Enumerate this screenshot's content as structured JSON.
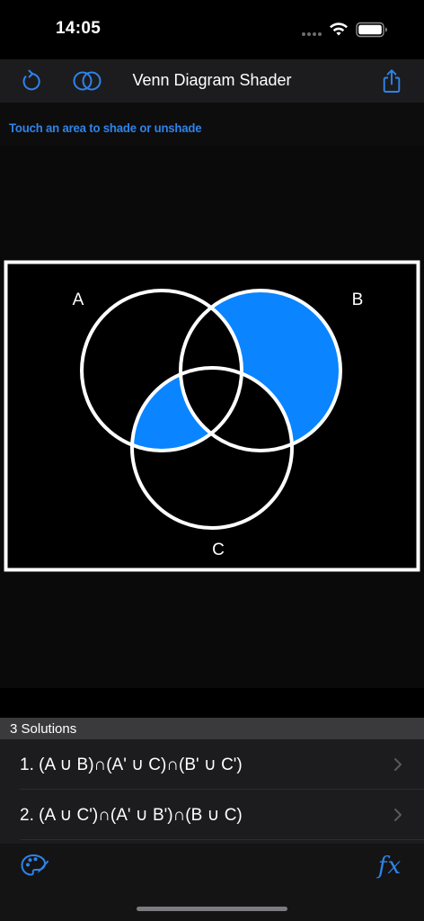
{
  "status_bar": {
    "time": "14:05"
  },
  "nav": {
    "title": "Venn Diagram Shader",
    "refresh_icon": "refresh-icon",
    "venn_icon": "venn-diagram-icon",
    "share_icon": "share-icon"
  },
  "hint": {
    "text": "Touch an area to shade or unshade"
  },
  "diagram": {
    "sets": [
      {
        "name": "A",
        "label": "A"
      },
      {
        "name": "B",
        "label": "B"
      },
      {
        "name": "C",
        "label": "C"
      }
    ],
    "shaded_regions": [
      "B only",
      "A and C only"
    ],
    "shade_color": "#0a84ff",
    "outline_color": "#ffffff"
  },
  "solutions": {
    "header": "3 Solutions",
    "items": [
      {
        "label": "1. (A ∪ B)∩(A' ∪ C)∩(B' ∪ C')"
      },
      {
        "label": "2. (A ∪ C')∩(A' ∪ B')∩(B ∪ C)"
      }
    ]
  },
  "toolbar": {
    "palette_icon": "palette-icon",
    "fx_label": "fx"
  },
  "colors": {
    "accent": "#2f83e8",
    "background": "#000000",
    "bar": "#1c1c1e"
  }
}
